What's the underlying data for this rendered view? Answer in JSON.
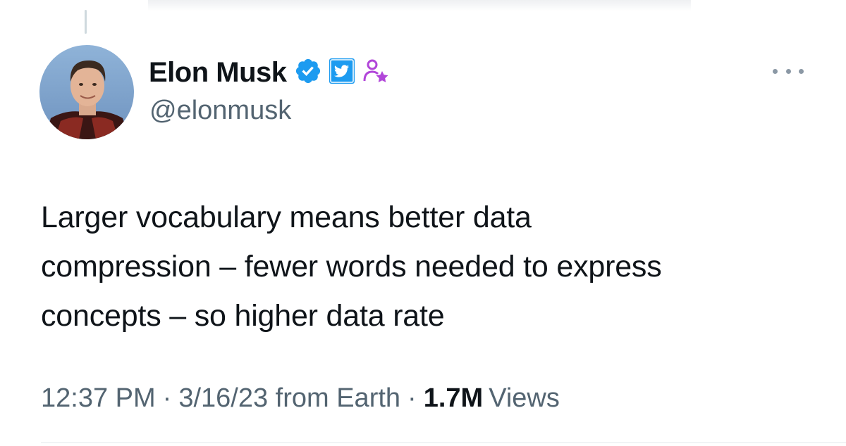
{
  "author": {
    "display_name": "Elon Musk",
    "handle": "@elonmusk",
    "badges": [
      "verified-badge-icon",
      "twitter-affiliate-icon",
      "employee-badge-icon"
    ]
  },
  "tweet": {
    "lines": [
      "Larger vocabulary means better data",
      "compression – fewer words needed to express",
      "concepts – so higher data rate"
    ]
  },
  "meta": {
    "time": "12:37 PM",
    "separator": "·",
    "date_source": "3/16/23 from Earth",
    "views_count": "1.7M",
    "views_label": "Views"
  },
  "colors": {
    "verified": "#1d9bf0",
    "twitter_blue": "#1d9bf0",
    "employee_badge": "#a855f7",
    "secondary_text": "#536471",
    "primary_text": "#0f1419"
  }
}
